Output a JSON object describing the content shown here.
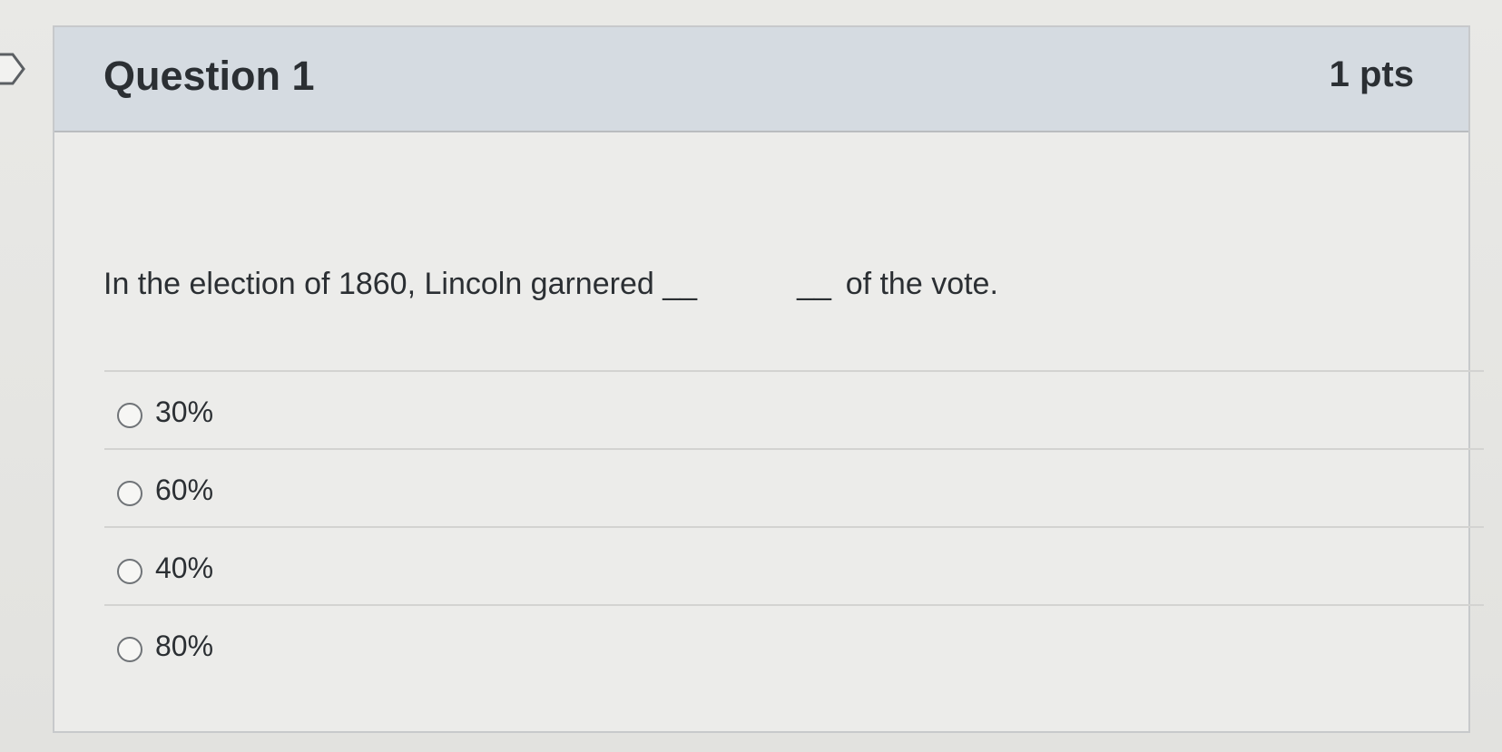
{
  "question": {
    "title": "Question 1",
    "points": "1 pts",
    "text_before": "In the election of 1860, Lincoln garnered",
    "blank_left": "__",
    "blank_right": "__",
    "text_after": "of the vote."
  },
  "answers": [
    {
      "label": "30%",
      "selected": false
    },
    {
      "label": "60%",
      "selected": false
    },
    {
      "label": "40%",
      "selected": false
    },
    {
      "label": "80%",
      "selected": false
    }
  ],
  "icons": {
    "flag": "flag-marker-icon",
    "radio": "radio-button-icon"
  },
  "colors": {
    "header_bg": "#d5dbe1",
    "card_bg": "#ececea",
    "text": "#2b2f33",
    "border": "#c7c9cb"
  }
}
